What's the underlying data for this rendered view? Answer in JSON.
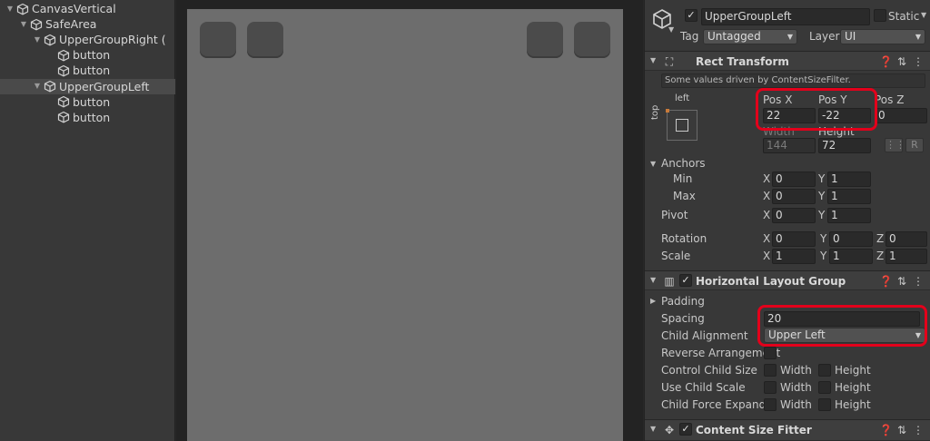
{
  "hierarchy": {
    "items": [
      {
        "label": "CanvasVertical",
        "depth": 0,
        "expanded": true,
        "selected": false
      },
      {
        "label": "SafeArea",
        "depth": 1,
        "expanded": true,
        "selected": false
      },
      {
        "label": "UpperGroupRight (",
        "depth": 2,
        "expanded": true,
        "selected": false
      },
      {
        "label": "button",
        "depth": 3,
        "expanded": null,
        "selected": false
      },
      {
        "label": "button",
        "depth": 3,
        "expanded": null,
        "selected": false
      },
      {
        "label": "UpperGroupLeft",
        "depth": 2,
        "expanded": true,
        "selected": true
      },
      {
        "label": "button",
        "depth": 3,
        "expanded": null,
        "selected": false
      },
      {
        "label": "button",
        "depth": 3,
        "expanded": null,
        "selected": false
      }
    ]
  },
  "inspector": {
    "object_name": "UpperGroupLeft",
    "static_label": "Static",
    "tag_label": "Tag",
    "tag_value": "Untagged",
    "layer_label": "Layer",
    "layer_value": "UI",
    "rect_transform": {
      "title": "Rect Transform",
      "driven_note": "Some values driven by ContentSizeFilter.",
      "anchor_preset_h": "left",
      "anchor_preset_v": "top",
      "pos_x_label": "Pos X",
      "pos_y_label": "Pos Y",
      "pos_z_label": "Pos Z",
      "pos_x": "22",
      "pos_y": "-22",
      "pos_z": "0",
      "width_label": "Width",
      "height_label": "Height",
      "width": "144",
      "height": "72",
      "r_button": "R",
      "anchors_label": "Anchors",
      "min_label": "Min",
      "max_label": "Max",
      "min_x": "0",
      "min_y": "1",
      "max_x": "0",
      "max_y": "1",
      "pivot_label": "Pivot",
      "pivot_x": "0",
      "pivot_y": "1",
      "rotation_label": "Rotation",
      "rot_x": "0",
      "rot_y": "0",
      "rot_z": "0",
      "scale_label": "Scale",
      "scale_x": "1",
      "scale_y": "1",
      "scale_z": "1",
      "x": "X",
      "y": "Y",
      "z": "Z"
    },
    "hlg": {
      "title": "Horizontal Layout Group",
      "padding_label": "Padding",
      "spacing_label": "Spacing",
      "spacing": "20",
      "child_alignment_label": "Child Alignment",
      "child_alignment": "Upper Left",
      "reverse_label": "Reverse Arrangement",
      "control_child_size_label": "Control Child Size",
      "use_child_scale_label": "Use Child Scale",
      "child_force_expand_label": "Child Force Expand",
      "width_opt": "Width",
      "height_opt": "Height"
    },
    "csf": {
      "title": "Content Size Fitter"
    }
  },
  "colors": {
    "highlight": "#e3001b",
    "panel": "#383838",
    "scene_canvas": "#6d6d6d",
    "ui_button": "#4b4b4b"
  }
}
